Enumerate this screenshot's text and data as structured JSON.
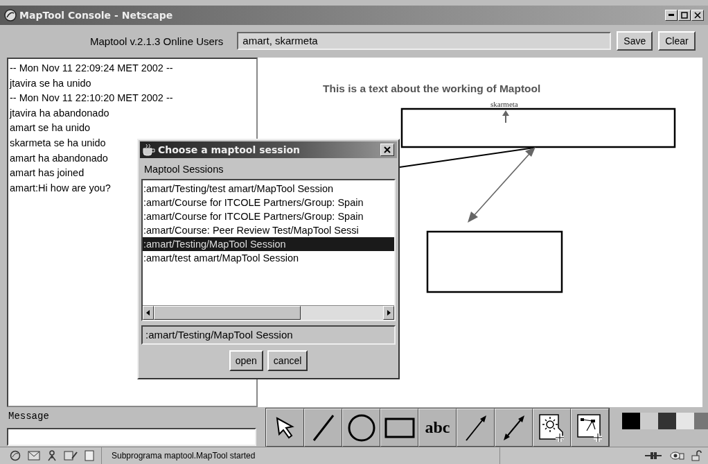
{
  "window": {
    "title": "MapTool Console - Netscape"
  },
  "header": {
    "label": "Maptool v.2.1.3 Online Users",
    "online_users": "amart, skarmeta",
    "buttons": [
      "Save",
      "Clear"
    ]
  },
  "chat_log": [
    "-- Mon Nov 11 22:09:24 MET 2002 --",
    "jtavira se ha unido",
    "-- Mon Nov 11 22:10:20 MET 2002 --",
    "jtavira ha abandonado",
    "amart se ha unido",
    "skarmeta se ha unido",
    "amart ha abandonado",
    "amart has joined",
    "amart:Hi how are you?"
  ],
  "canvas": {
    "title_text": "This is a text about the working of Maptool",
    "author_label": "skarmeta"
  },
  "dialog": {
    "title": "Choose a maptool session",
    "list_label": "Maptool Sessions",
    "sessions": [
      {
        "label": ":amart/Testing/test amart/MapTool Session",
        "selected": false
      },
      {
        "label": ":amart/Course for ITCOLE Partners/Group: Spain",
        "selected": false
      },
      {
        "label": ":amart/Course for ITCOLE Partners/Group: Spain",
        "selected": false
      },
      {
        "label": ":amart/Course: Peer Review Test/MapTool Sessi",
        "selected": false
      },
      {
        "label": ":amart/Testing/MapTool Session",
        "selected": true
      },
      {
        "label": ":amart/test amart/MapTool Session",
        "selected": false
      }
    ],
    "selected_session": ":amart/Testing/MapTool Session",
    "buttons": [
      "open",
      "cancel"
    ]
  },
  "message": {
    "label": "Message"
  },
  "tools": [
    {
      "kind": "pointer"
    },
    {
      "kind": "line"
    },
    {
      "kind": "ellipse"
    },
    {
      "kind": "rectangle"
    },
    {
      "kind": "text",
      "label": "abc"
    },
    {
      "kind": "arrow"
    },
    {
      "kind": "double-arrow"
    },
    {
      "kind": "add-image"
    },
    {
      "kind": "add-map"
    }
  ],
  "palette": [
    {
      "color": "#000000"
    },
    {
      "color": "#cccccc"
    },
    {
      "color": "#333333"
    },
    {
      "color": "#e6e6e6"
    },
    {
      "color": "#777777"
    }
  ],
  "status_bar": {
    "text": "Subprograma maptool.MapTool started"
  }
}
